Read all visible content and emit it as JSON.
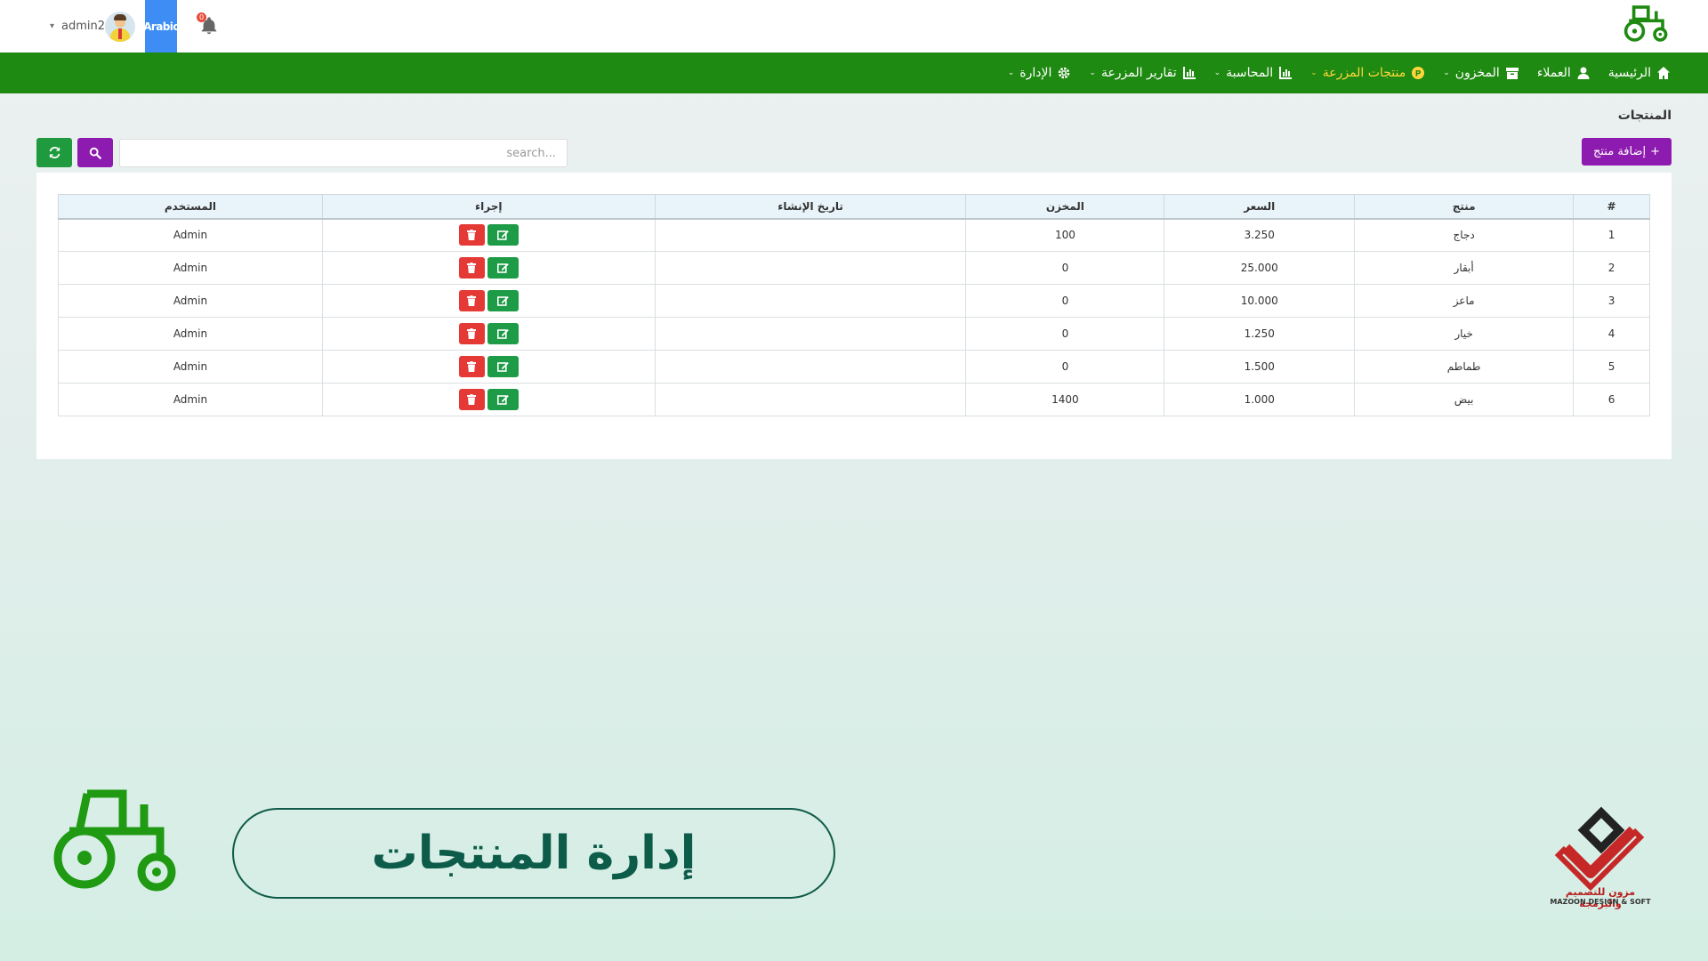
{
  "header": {
    "user_name": "admin2",
    "language": "Arabic",
    "notifications_count": "0"
  },
  "nav": {
    "items": [
      {
        "label": "الرئيسية",
        "icon": "home-icon"
      },
      {
        "label": "العملاء",
        "icon": "user-icon"
      },
      {
        "label": "المخزون",
        "icon": "box-icon"
      },
      {
        "label": "منتجات المزرعة",
        "icon": "product-icon",
        "active": true
      },
      {
        "label": "المحاسبة",
        "icon": "chart-icon"
      },
      {
        "label": "تقارير المزرعة",
        "icon": "chart-icon"
      },
      {
        "label": "الإدارة",
        "icon": "gear-icon"
      }
    ]
  },
  "page": {
    "title": "المنتجات",
    "add_button": "إضافة منتج",
    "search_placeholder": "search..."
  },
  "table": {
    "columns": [
      "#",
      "منتج",
      "السعر",
      "المخزن",
      "تاريخ الإنشاء",
      "إجراء",
      "المستخدم"
    ],
    "rows": [
      {
        "num": "1",
        "product": "دجاج",
        "price": "3.250",
        "stock": "100",
        "created": "",
        "user": "Admin"
      },
      {
        "num": "2",
        "product": "أبقار",
        "price": "25.000",
        "stock": "0",
        "created": "",
        "user": "Admin"
      },
      {
        "num": "3",
        "product": "ماعز",
        "price": "10.000",
        "stock": "0",
        "created": "",
        "user": "Admin"
      },
      {
        "num": "4",
        "product": "خيار",
        "price": "1.250",
        "stock": "0",
        "created": "",
        "user": "Admin"
      },
      {
        "num": "5",
        "product": "طماطم",
        "price": "1.500",
        "stock": "0",
        "created": "",
        "user": "Admin"
      },
      {
        "num": "6",
        "product": "بيض",
        "price": "1.000",
        "stock": "1400",
        "created": "",
        "user": "Admin"
      }
    ]
  },
  "banner": {
    "title": "إدارة المنتجات",
    "brand_ar": "مزون للتصميم والبرمجة",
    "brand_en": "MAZOON DESIGN & SOFT"
  },
  "colors": {
    "nav_green": "#1f8a12",
    "accent_purple": "#8e1bb0",
    "delete_red": "#e53935",
    "edit_green": "#1e9b47",
    "active_nav": "#ffd63a"
  }
}
